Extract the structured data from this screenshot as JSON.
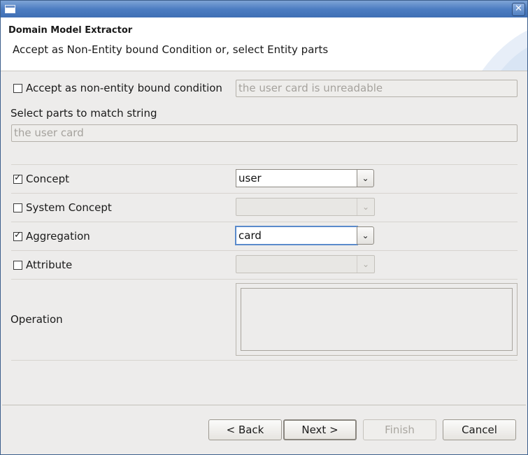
{
  "window": {
    "title": ""
  },
  "header": {
    "title": "Domain Model Extractor",
    "subtitle": "Accept as Non-Entity bound Condition or, select Entity parts"
  },
  "non_entity": {
    "label": "Accept as non-entity bound condition",
    "checked": false,
    "value": "the user card is unreadable"
  },
  "match": {
    "label": "Select parts to match string",
    "value": "the user card"
  },
  "rows": [
    {
      "label": "Concept",
      "checked": true,
      "value": "user",
      "enabled": true
    },
    {
      "label": "System Concept",
      "checked": false,
      "value": "",
      "enabled": false
    },
    {
      "label": "Aggregation",
      "checked": true,
      "value": "card",
      "enabled": true
    },
    {
      "label": "Attribute",
      "checked": false,
      "value": "",
      "enabled": false
    }
  ],
  "operation": {
    "label": "Operation"
  },
  "buttons": {
    "back": "< Back",
    "next": "Next >",
    "finish": "Finish",
    "cancel": "Cancel"
  }
}
